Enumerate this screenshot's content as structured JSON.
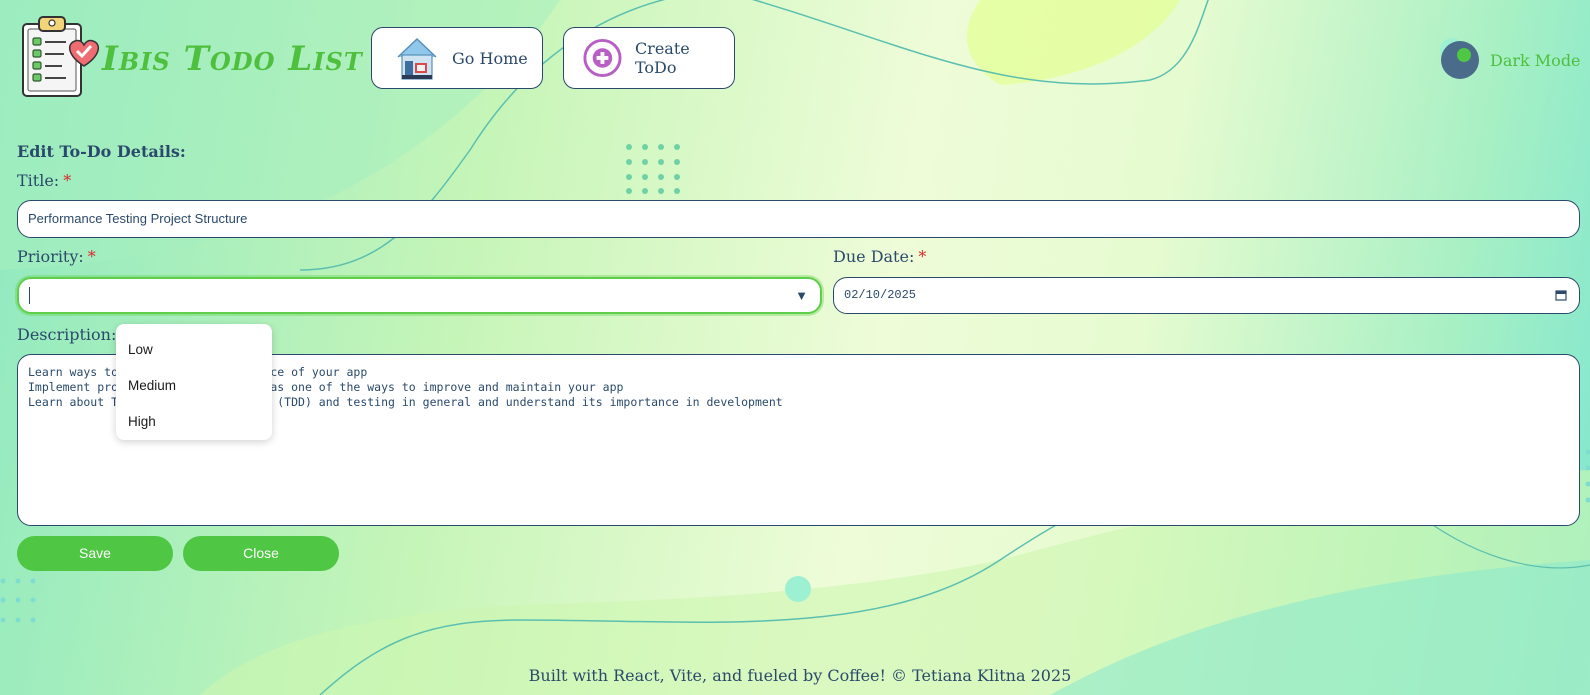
{
  "header": {
    "app_title": "Ibis Todo List",
    "nav": {
      "home_label": "Go Home",
      "create_label": "Create ToDo"
    },
    "dark_mode_label": "Dark Mode"
  },
  "form": {
    "section_title": "Edit To-Do Details:",
    "title": {
      "label": "Title:",
      "required_mark": "*",
      "value": "Performance Testing Project Structure"
    },
    "priority": {
      "label": "Priority:",
      "required_mark": "*",
      "value": "",
      "options": [
        "Low",
        "Medium",
        "High"
      ]
    },
    "due_date": {
      "label": "Due Date:",
      "required_mark": "*",
      "value": "02/10/2025"
    },
    "description": {
      "label": "Description:",
      "value": "Learn ways to improve the performance of your app\nImplement proper project structure as one of the ways to improve and maintain your app\nLearn about Test Driven Development (TDD) and testing in general and understand its importance in development"
    },
    "buttons": {
      "save_label": "Save",
      "close_label": "Close"
    }
  },
  "footer": {
    "text": "Built with React, Vite, and fueled by Coffee! © Tetiana Klitna 2025"
  },
  "colors": {
    "accent_green": "#4fc644",
    "navy": "#2b4a6b",
    "required_red": "#d62b2b"
  }
}
